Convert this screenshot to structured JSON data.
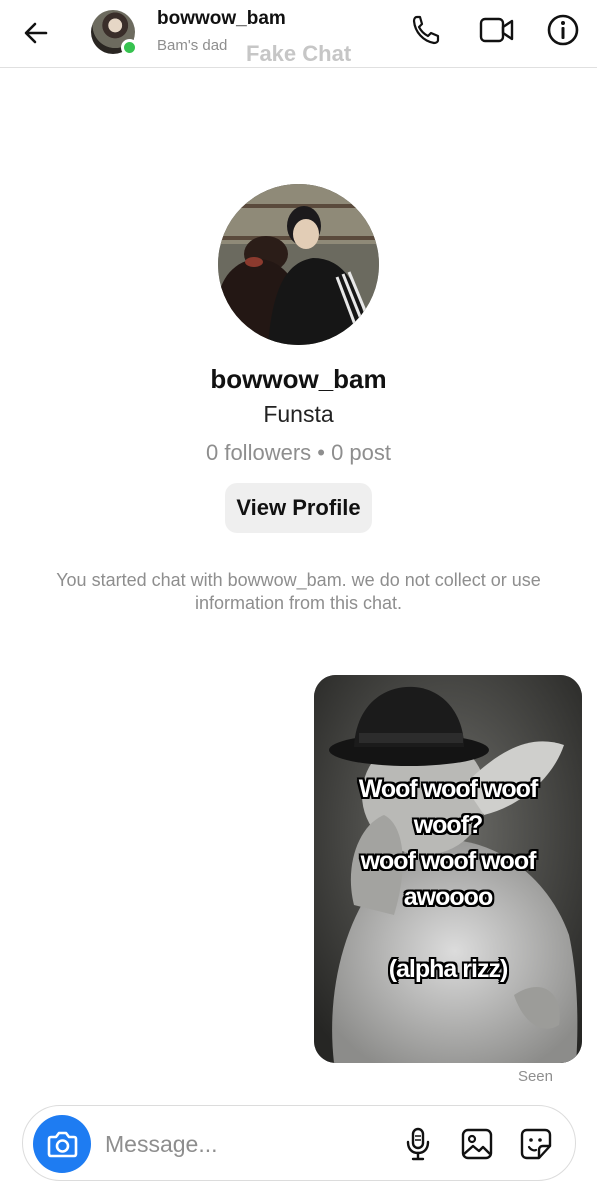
{
  "header": {
    "username": "bowwow_bam",
    "subtitle": "Bam's dad",
    "watermark": "Fake Chat",
    "icons": [
      "back-arrow-icon",
      "phone-icon",
      "video-camera-icon",
      "info-icon"
    ]
  },
  "profile": {
    "name": "bowwow_bam",
    "bio": "Funsta",
    "stats": "0 followers • 0 post",
    "view_profile_label": "View Profile"
  },
  "notice": "You started chat with bowwow_bam. we do not collect or use information from this chat.",
  "message": {
    "caption": "Woof woof woof\nwoof?\nwoof woof woof\nawoooo\n\n(alpha rizz)",
    "status": "Seen"
  },
  "composer": {
    "placeholder": "Message...",
    "icons": [
      "camera-icon",
      "microphone-icon",
      "gallery-icon",
      "sticker-icon"
    ]
  },
  "colors": {
    "accent": "#1e7cf2",
    "online": "#36c24f",
    "muted_text": "#8e8e8e",
    "button_bg": "#efefef"
  }
}
